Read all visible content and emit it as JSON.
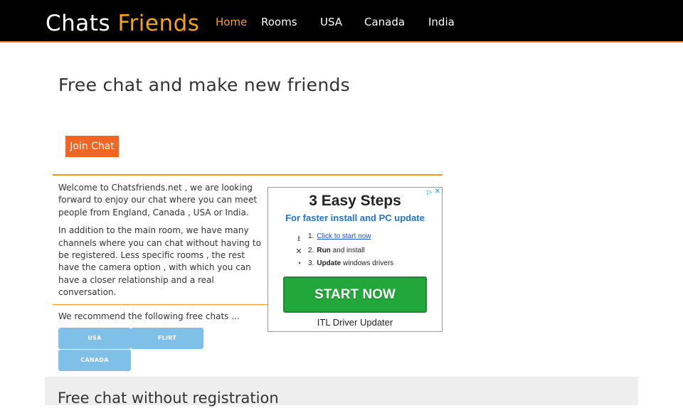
{
  "brand": {
    "part1": "Chats",
    "part2": "Friends"
  },
  "nav": {
    "items": [
      {
        "label": "Home"
      },
      {
        "label": "Rooms"
      },
      {
        "label": "USA"
      },
      {
        "label": "Canada"
      },
      {
        "label": "India"
      }
    ]
  },
  "main": {
    "title": "Free chat and make new friends",
    "join_label": "Join Chat",
    "intro": [
      "Welcome to Chatsfriends.net , we are looking forward to enjoy our chat where you can meet people from England, Canada , USA or India.",
      "In addition to the main room, we have many channels where you can chat without having to be registered. Less specific rooms , the rest have the camera option , with which you can have a closer relationship and a real conversation."
    ],
    "recommend": "We recommend the following free chats ...",
    "chats": [
      "USA",
      "FLIRT",
      "CANADA"
    ]
  },
  "ad": {
    "title": "3 Easy Steps",
    "subtitle": "For faster install and PC update",
    "steps": [
      {
        "num": "1.",
        "text": "Click to start now"
      },
      {
        "num": "2.",
        "bold": "Run",
        "text": "and install"
      },
      {
        "num": "3.",
        "bold": "Update",
        "text": "windows drivers"
      }
    ],
    "button": "START NOW",
    "footer": "ITL Driver Updater"
  },
  "lower": {
    "title": "Free chat without registration"
  },
  "colors": {
    "accent": "#f7941d",
    "brand_orange": "#f7a21b",
    "button_orange": "#f26522",
    "pill_blue": "#7ec0e8",
    "ad_green": "#22a83a"
  }
}
